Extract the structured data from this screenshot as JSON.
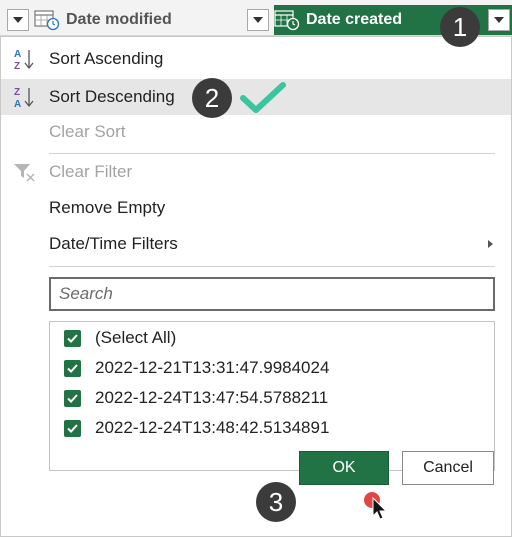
{
  "header": {
    "col_modified_label": "Date modified",
    "col_created_label": "Date created"
  },
  "menu": {
    "sort_ascending": "Sort Ascending",
    "sort_descending": "Sort Descending",
    "clear_sort": "Clear Sort",
    "clear_filter": "Clear Filter",
    "remove_empty": "Remove Empty",
    "date_time_filters": "Date/Time Filters"
  },
  "search": {
    "placeholder": "Search",
    "value": ""
  },
  "list": {
    "items": [
      {
        "label": "(Select All)",
        "checked": true
      },
      {
        "label": "2022-12-21T13:31:47.9984024",
        "checked": true
      },
      {
        "label": "2022-12-24T13:47:54.5788211",
        "checked": true
      },
      {
        "label": "2022-12-24T13:48:42.5134891",
        "checked": true
      }
    ]
  },
  "buttons": {
    "ok": "OK",
    "cancel": "Cancel"
  },
  "steps": [
    "1",
    "2",
    "3"
  ],
  "colors": {
    "accent_green": "#217346",
    "badge": "#3b3b3b",
    "checkmark": "#3cc3a0",
    "click_dot": "#e04848"
  }
}
